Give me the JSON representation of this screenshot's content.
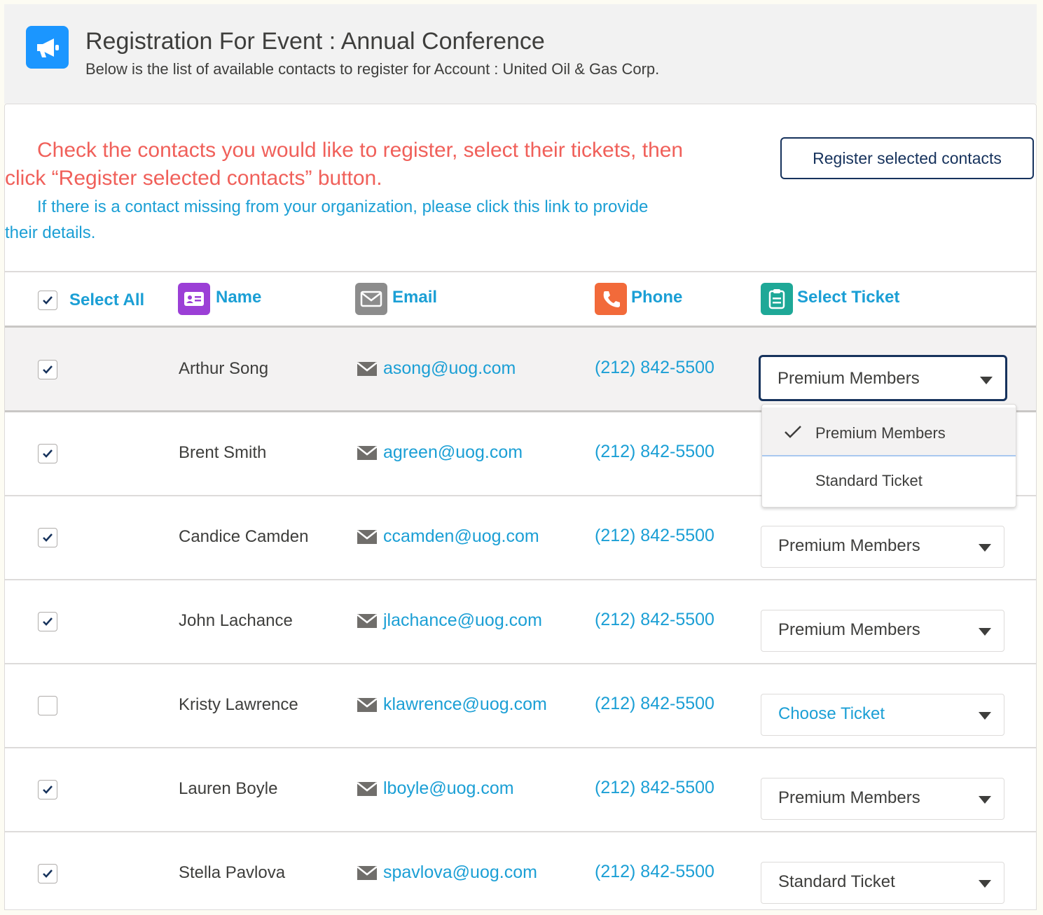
{
  "header": {
    "title": "Registration For Event : Annual Conference",
    "subtitle": "Below is the list of available contacts to register for Account : United Oil & Gas Corp.",
    "icon": "megaphone-icon",
    "icon_color": "#1b96ff"
  },
  "instructions": {
    "primary": "Check the contacts you would like to register, select their tickets, then click “Register selected contacts” button.",
    "missing_link": "If there is a contact missing from your organization, please click this link to provide their details."
  },
  "actions": {
    "register_label": "Register selected contacts"
  },
  "table": {
    "select_all_label": "Select All",
    "select_all_checked": true,
    "columns": {
      "name": "Name",
      "email": "Email",
      "phone": "Phone",
      "ticket": "Select Ticket"
    },
    "column_icon_colors": {
      "name": "#9b3fd6",
      "email": "#8c8c8c",
      "phone": "#f26a3a",
      "ticket": "#1ea897"
    },
    "rows": [
      {
        "checked": true,
        "name": "Arthur Song",
        "email": "asong@uog.com",
        "phone": "(212) 842-5500",
        "ticket": "Premium Members"
      },
      {
        "checked": true,
        "name": "Brent Smith",
        "email": "agreen@uog.com",
        "phone": "(212) 842-5500",
        "ticket": ""
      },
      {
        "checked": true,
        "name": "Candice Camden",
        "email": "ccamden@uog.com",
        "phone": "(212) 842-5500",
        "ticket": "Premium Members"
      },
      {
        "checked": true,
        "name": "John Lachance",
        "email": "jlachance@uog.com",
        "phone": "(212) 842-5500",
        "ticket": "Premium Members"
      },
      {
        "checked": false,
        "name": "Kristy Lawrence",
        "email": "klawrence@uog.com",
        "phone": "(212) 842-5500",
        "ticket": "Choose Ticket"
      },
      {
        "checked": true,
        "name": "Lauren Boyle",
        "email": "lboyle@uog.com",
        "phone": "(212) 842-5500",
        "ticket": "Premium Members"
      },
      {
        "checked": true,
        "name": "Stella Pavlova",
        "email": "spavlova@uog.com",
        "phone": "(212) 842-5500",
        "ticket": "Standard Ticket"
      }
    ]
  },
  "ticket_dropdown": {
    "options": [
      "Premium Members",
      "Standard Ticket"
    ],
    "selected": "Premium Members"
  }
}
